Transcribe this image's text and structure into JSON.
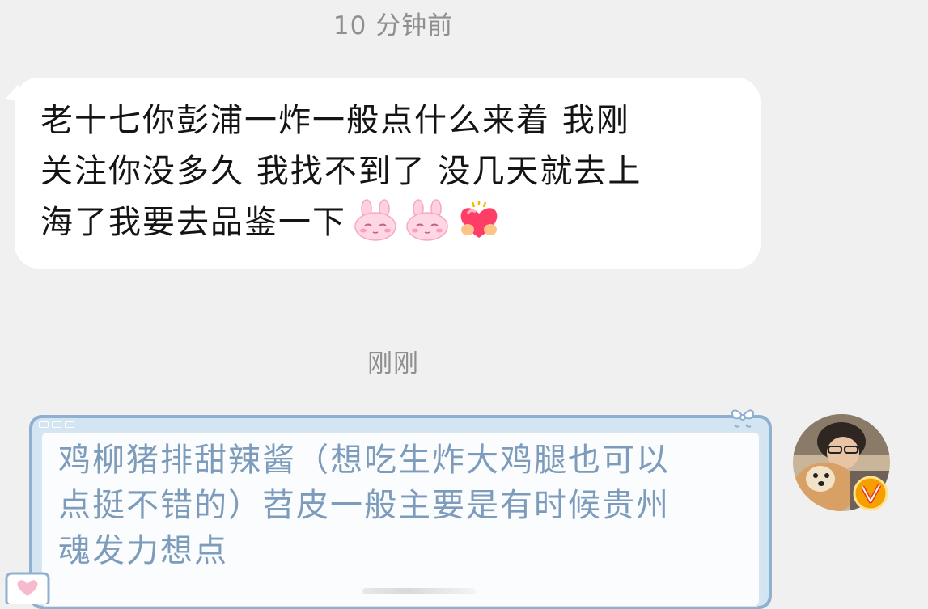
{
  "chat": {
    "timestamp_1": "10 分钟前",
    "incoming_message": "老十七你彭浦一炸一般点什么来着 我刚\n关注你没多久 我找不到了 没几天就去上\n海了我要去品鉴一下",
    "incoming_emojis": [
      "bunny-blush-emoji",
      "bunny-blush-emoji",
      "heart-hug-emoji"
    ],
    "timestamp_2": "刚刚",
    "outgoing_message": "鸡柳猪排甜辣酱（想吃生炸大鸡腿也可以\n点挺不错的）苕皮一般主要是有时候贵州\n魂发力想点"
  },
  "avatar": {
    "badge_icon": "verified-v-badge-icon",
    "badge_color": "#f5a000"
  },
  "colors": {
    "background": "#f0f0f0",
    "incoming_bubble": "#ffffff",
    "outgoing_bubble_border": "#8fb0cf",
    "outgoing_text": "#7d9cbb"
  }
}
